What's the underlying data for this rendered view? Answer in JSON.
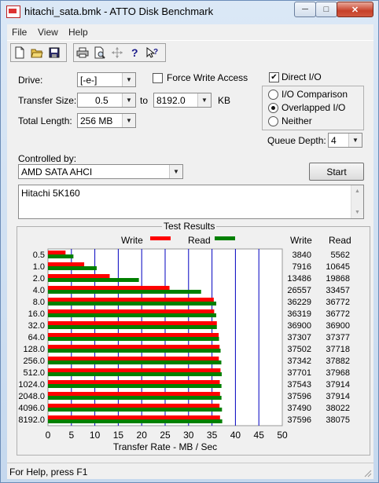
{
  "window": {
    "title": "hitachi_sata.bmk - ATTO Disk Benchmark"
  },
  "menu": {
    "file": "File",
    "view": "View",
    "help": "Help"
  },
  "toolbar": {
    "icons": [
      "new-icon",
      "open-icon",
      "save-icon",
      "print-icon",
      "print-preview-icon",
      "move-icon",
      "help-icon",
      "context-help-icon"
    ]
  },
  "form": {
    "drive_label": "Drive:",
    "drive_value": "[-e-]",
    "force_write_label": "Force Write Access",
    "force_write_checked": false,
    "direct_io_label": "Direct I/O",
    "direct_io_checked": true,
    "transfer_size_label": "Transfer Size:",
    "transfer_from": "0.5",
    "to_label": "to",
    "transfer_to": "8192.0",
    "kb_label": "KB",
    "total_length_label": "Total Length:",
    "total_length_value": "256 MB",
    "io_options": [
      {
        "label": "I/O Comparison",
        "selected": false
      },
      {
        "label": "Overlapped I/O",
        "selected": true
      },
      {
        "label": "Neither",
        "selected": false
      }
    ],
    "queue_depth_label": "Queue Depth:",
    "queue_depth_value": "4",
    "controlled_by_label": "Controlled by:",
    "controller_value": "AMD SATA AHCI",
    "start_label": "Start",
    "description": "Hitachi 5K160"
  },
  "results": {
    "title": "Test Results",
    "legend_write": "Write",
    "legend_read": "Read",
    "col_write": "Write",
    "col_read": "Read"
  },
  "chart_data": {
    "type": "bar",
    "orientation": "horizontal",
    "categories": [
      "0.5",
      "1.0",
      "2.0",
      "4.0",
      "8.0",
      "16.0",
      "32.0",
      "64.0",
      "128.0",
      "256.0",
      "512.0",
      "1024.0",
      "2048.0",
      "4096.0",
      "8192.0"
    ],
    "series": [
      {
        "name": "Write",
        "color": "#ff0000",
        "values": [
          3840,
          7916,
          13486,
          26557,
          36229,
          36319,
          36900,
          37307,
          37502,
          37342,
          37701,
          37543,
          37596,
          37490,
          37596
        ]
      },
      {
        "name": "Read",
        "color": "#008000",
        "values": [
          5562,
          10645,
          19868,
          33457,
          36772,
          36772,
          36900,
          37377,
          37718,
          37882,
          37968,
          37914,
          37914,
          38022,
          38075
        ]
      }
    ],
    "xlabel": "Transfer Rate - MB / Sec",
    "xticks": [
      "0",
      "5",
      "10",
      "15",
      "20",
      "25",
      "30",
      "35",
      "40",
      "45",
      "50"
    ],
    "xlim": [
      0,
      50
    ],
    "grid": "vertical",
    "grid_color": "#0000c0"
  },
  "status": {
    "text": "For Help, press F1"
  }
}
